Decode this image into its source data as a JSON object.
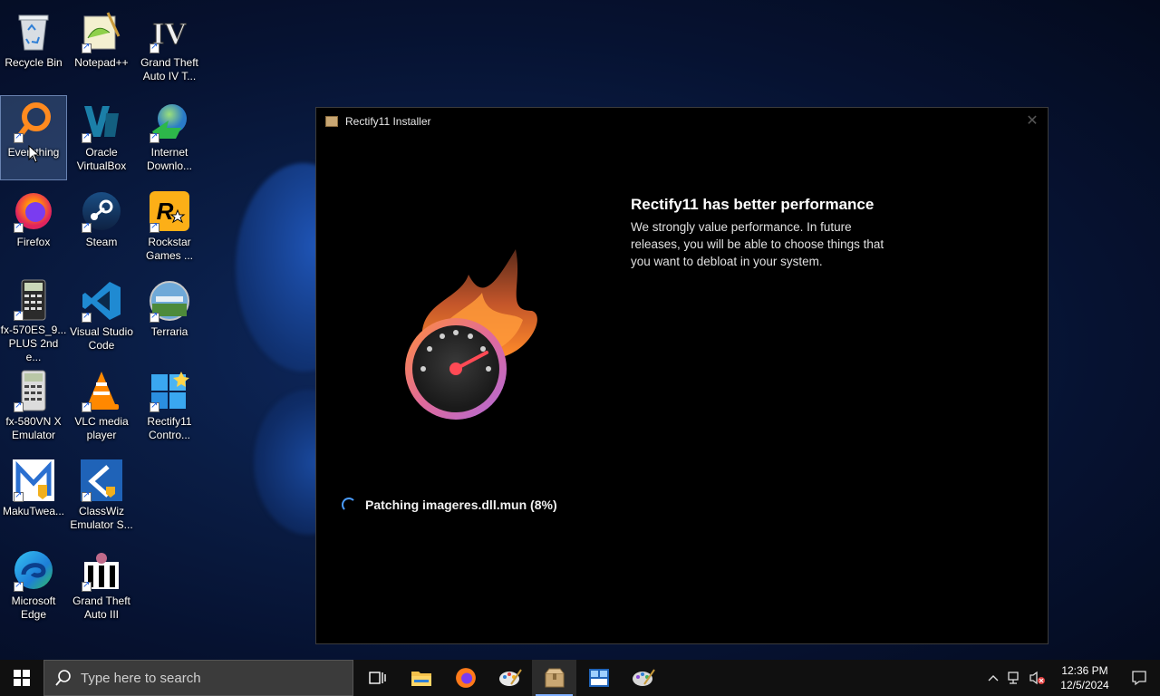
{
  "desktop": {
    "icons": [
      {
        "label": "Recycle Bin",
        "icon": "recycle-bin-icon"
      },
      {
        "label": "Notepad++",
        "icon": "notepad-plus-plus-icon"
      },
      {
        "label": "Grand Theft Auto IV T...",
        "icon": "gta-iv-icon"
      },
      {
        "label": "Everything",
        "icon": "everything-search-icon"
      },
      {
        "label": "Oracle VirtualBox",
        "icon": "virtualbox-icon"
      },
      {
        "label": "Internet Downlo...",
        "icon": "internet-download-manager-icon"
      },
      {
        "label": "Firefox",
        "icon": "firefox-icon"
      },
      {
        "label": "Steam",
        "icon": "steam-icon"
      },
      {
        "label": "Rockstar Games ...",
        "icon": "rockstar-games-icon"
      },
      {
        "label": "fx-570ES_9... PLUS 2nd e...",
        "icon": "calculator-icon"
      },
      {
        "label": "Visual Studio Code",
        "icon": "vscode-icon"
      },
      {
        "label": "Terraria",
        "icon": "terraria-icon"
      },
      {
        "label": "fx-580VN X Emulator",
        "icon": "calculator-icon"
      },
      {
        "label": "VLC media player",
        "icon": "vlc-icon"
      },
      {
        "label": "Rectify11 Contro...",
        "icon": "rectify11-control-icon"
      },
      {
        "label": "MakuTwea...",
        "icon": "makutweaker-icon"
      },
      {
        "label": "ClassWiz Emulator S...",
        "icon": "classwiz-icon"
      },
      {
        "label": "Microsoft Edge",
        "icon": "edge-icon"
      },
      {
        "label": "Grand Theft Auto III",
        "icon": "gta-iii-icon"
      }
    ]
  },
  "installer": {
    "title": "Rectify11 Installer",
    "heading": "Rectify11 has better performance",
    "description": "We strongly value performance. In future releases, you will be able to choose things that you want to debloat in your system.",
    "status": "Patching imageres.dll.mun (8%)",
    "progress_percent": 8
  },
  "taskbar": {
    "search_placeholder": "Type here to search",
    "time": "12:36 PM",
    "date": "12/5/2024"
  }
}
